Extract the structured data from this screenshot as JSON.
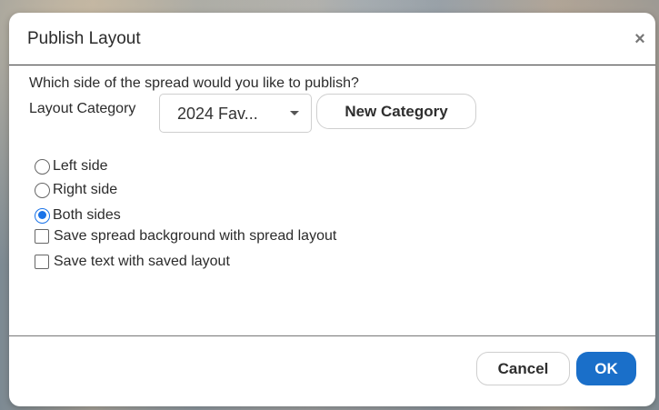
{
  "dialog": {
    "title": "Publish Layout",
    "close_icon": "close-icon",
    "question": "Which side of the spread would you like to publish?",
    "category_label": "Layout Category",
    "category_select": {
      "value": "2024 Fav...",
      "icon": "chevron-down-icon"
    },
    "new_category_label": "New Category",
    "radios": [
      {
        "label": "Left side",
        "checked": false
      },
      {
        "label": "Right side",
        "checked": false
      },
      {
        "label": "Both sides",
        "checked": true
      }
    ],
    "checkboxes": [
      {
        "label": "Save spread background with spread layout",
        "checked": false
      },
      {
        "label": "Save text with saved layout",
        "checked": false
      }
    ],
    "cancel_label": "Cancel",
    "ok_label": "OK"
  },
  "colors": {
    "accent": "#1a6fc9",
    "radio_selected": "#1a73e8",
    "text": "#2b2b2b"
  }
}
